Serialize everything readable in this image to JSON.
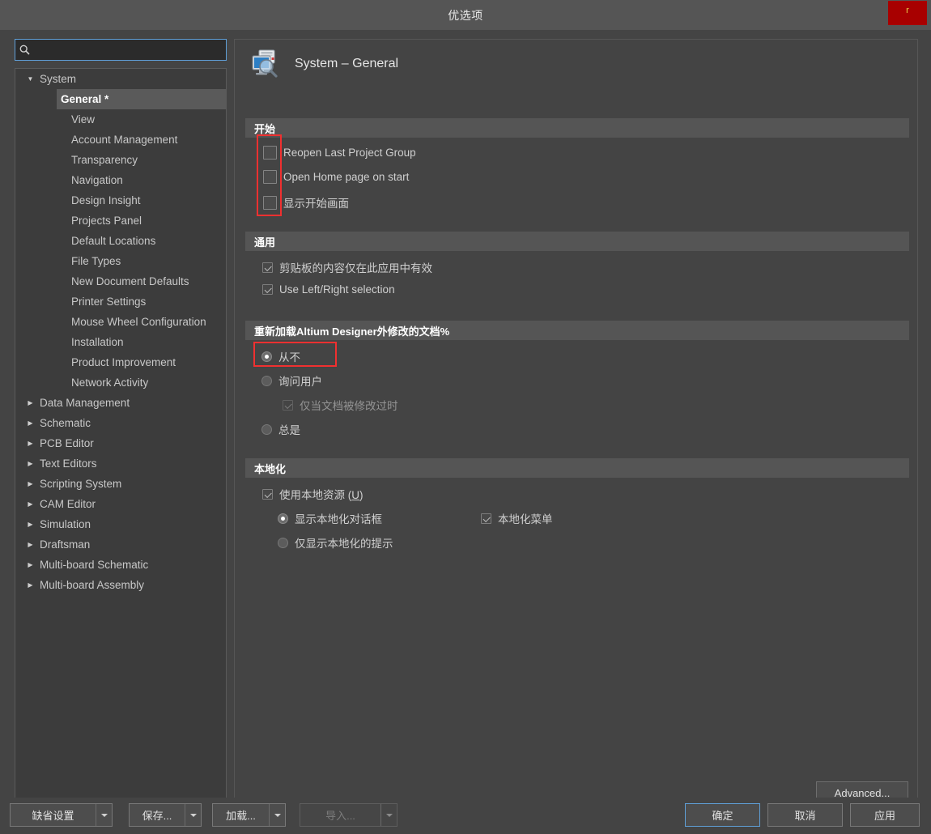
{
  "window": {
    "title": "优选项",
    "badge_label": "r"
  },
  "search": {
    "icon": "search-icon",
    "value": "",
    "placeholder": ""
  },
  "tree": {
    "items": [
      {
        "label": "System",
        "level": 0,
        "expanded": true,
        "selected": false,
        "has_children": true
      },
      {
        "label": "General *",
        "level": 1,
        "expanded": false,
        "selected": true,
        "has_children": false
      },
      {
        "label": "View",
        "level": 1,
        "expanded": false,
        "selected": false,
        "has_children": false
      },
      {
        "label": "Account Management",
        "level": 1,
        "expanded": false,
        "selected": false,
        "has_children": false
      },
      {
        "label": "Transparency",
        "level": 1,
        "expanded": false,
        "selected": false,
        "has_children": false
      },
      {
        "label": "Navigation",
        "level": 1,
        "expanded": false,
        "selected": false,
        "has_children": false
      },
      {
        "label": "Design Insight",
        "level": 1,
        "expanded": false,
        "selected": false,
        "has_children": false
      },
      {
        "label": "Projects Panel",
        "level": 1,
        "expanded": false,
        "selected": false,
        "has_children": false
      },
      {
        "label": "Default Locations",
        "level": 1,
        "expanded": false,
        "selected": false,
        "has_children": false
      },
      {
        "label": "File Types",
        "level": 1,
        "expanded": false,
        "selected": false,
        "has_children": false
      },
      {
        "label": "New Document Defaults",
        "level": 1,
        "expanded": false,
        "selected": false,
        "has_children": false
      },
      {
        "label": "Printer Settings",
        "level": 1,
        "expanded": false,
        "selected": false,
        "has_children": false
      },
      {
        "label": "Mouse Wheel Configuration",
        "level": 1,
        "expanded": false,
        "selected": false,
        "has_children": false
      },
      {
        "label": "Installation",
        "level": 1,
        "expanded": false,
        "selected": false,
        "has_children": false
      },
      {
        "label": "Product Improvement",
        "level": 1,
        "expanded": false,
        "selected": false,
        "has_children": false
      },
      {
        "label": "Network Activity",
        "level": 1,
        "expanded": false,
        "selected": false,
        "has_children": false
      },
      {
        "label": "Data Management",
        "level": 0,
        "expanded": false,
        "selected": false,
        "has_children": true
      },
      {
        "label": "Schematic",
        "level": 0,
        "expanded": false,
        "selected": false,
        "has_children": true
      },
      {
        "label": "PCB Editor",
        "level": 0,
        "expanded": false,
        "selected": false,
        "has_children": true
      },
      {
        "label": "Text Editors",
        "level": 0,
        "expanded": false,
        "selected": false,
        "has_children": true
      },
      {
        "label": "Scripting System",
        "level": 0,
        "expanded": false,
        "selected": false,
        "has_children": true
      },
      {
        "label": "CAM Editor",
        "level": 0,
        "expanded": false,
        "selected": false,
        "has_children": true
      },
      {
        "label": "Simulation",
        "level": 0,
        "expanded": false,
        "selected": false,
        "has_children": true
      },
      {
        "label": "Draftsman",
        "level": 0,
        "expanded": false,
        "selected": false,
        "has_children": true
      },
      {
        "label": "Multi-board Schematic",
        "level": 0,
        "expanded": false,
        "selected": false,
        "has_children": true
      },
      {
        "label": "Multi-board Assembly",
        "level": 0,
        "expanded": false,
        "selected": false,
        "has_children": true
      }
    ]
  },
  "page": {
    "icon": "system-general-icon",
    "title": "System – General",
    "sections": {
      "startup": {
        "header": "开始",
        "options": [
          {
            "label": "Reopen Last Project Group",
            "checked": false
          },
          {
            "label": "Open Home page on start",
            "checked": false
          },
          {
            "label": "显示开始画面",
            "checked": false
          }
        ]
      },
      "general": {
        "header": "通用",
        "options": [
          {
            "label": "剪贴板的内容仅在此应用中有效",
            "checked": true
          },
          {
            "label": "Use Left/Right selection",
            "checked": true
          }
        ]
      },
      "reload": {
        "header": "重新加载Altium Designer外修改的文档%",
        "options": [
          {
            "label": "从不",
            "selected": true
          },
          {
            "label": "询问用户",
            "selected": false
          },
          {
            "label": "总是",
            "selected": false
          }
        ],
        "sub_option": {
          "label": "仅当文档被修改过时",
          "checked": true,
          "disabled": true
        }
      },
      "localization": {
        "header": "本地化",
        "use_local_resources": {
          "label": "使用本地资源 (U)",
          "accel": "U",
          "checked": true
        },
        "radios": [
          {
            "label": "显示本地化对话框",
            "selected": true
          },
          {
            "label": "仅显示本地化的提示",
            "selected": false
          }
        ],
        "localized_menu": {
          "label": "本地化菜单",
          "checked": true
        }
      }
    },
    "advanced_button": "Advanced..."
  },
  "footer": {
    "defaults": "缺省设置",
    "save": "保存...",
    "load": "加载...",
    "import": "导入...",
    "ok": "确定",
    "cancel": "取消",
    "apply": "应用"
  },
  "colors": {
    "accent_focus": "#5f9ed6",
    "highlight_annotation": "#f03030",
    "window_badge": "#a80000"
  }
}
